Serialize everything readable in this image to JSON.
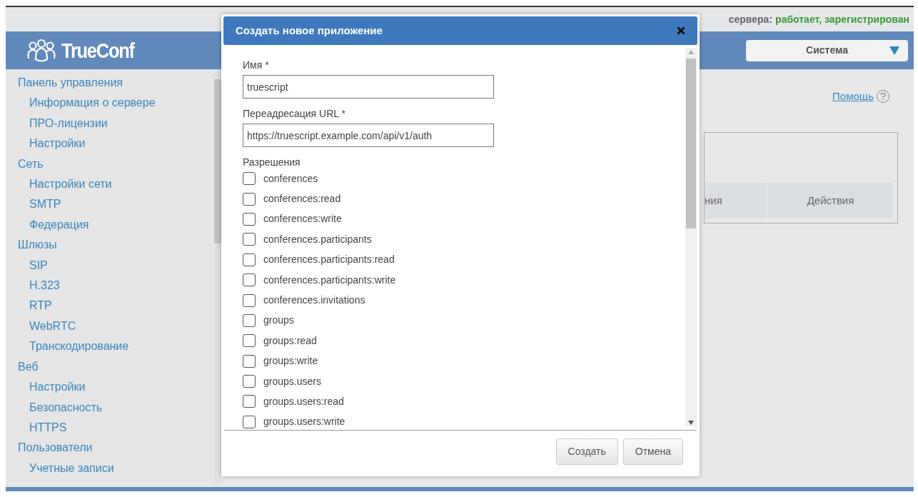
{
  "top_bar": {
    "status_label": "сервера:",
    "status_value": "работает, зарегистрирован"
  },
  "header": {
    "logo": "TrueConf",
    "menu": {
      "label": "Система",
      "expanded": false
    }
  },
  "sidebar": {
    "items": [
      {
        "label": "Панель управления",
        "children": [
          {
            "label": "Информация о сервере"
          },
          {
            "label": "ПРО-лицензии"
          },
          {
            "label": "Настройки"
          }
        ]
      },
      {
        "label": "Сеть",
        "children": [
          {
            "label": "Настройки сети"
          },
          {
            "label": "SMTP"
          },
          {
            "label": "Федерация"
          }
        ]
      },
      {
        "label": "Шлюзы",
        "children": [
          {
            "label": "SIP"
          },
          {
            "label": "H.323"
          },
          {
            "label": "RTP"
          },
          {
            "label": "WebRTC"
          },
          {
            "label": "Транскодирование"
          }
        ]
      },
      {
        "label": "Веб",
        "children": [
          {
            "label": "Настройки"
          },
          {
            "label": "Безопасность"
          },
          {
            "label": "HTTPS"
          }
        ]
      },
      {
        "label": "Пользователи",
        "children": [
          {
            "label": "Учетные записи"
          }
        ]
      }
    ]
  },
  "main": {
    "help_link": "Помощь",
    "table": {
      "columns": [
        "ния",
        "Действия"
      ]
    }
  },
  "dialog": {
    "title": "Создать новое приложение",
    "fields": [
      {
        "label": "Имя *",
        "value": "truescript"
      },
      {
        "label": "Переадресация URL *",
        "value": "https://truescript.example.com/api/v1/auth"
      }
    ],
    "permissions_label": "Разрешения",
    "permissions": [
      {
        "label": "conferences",
        "checked": false
      },
      {
        "label": "conferences:read",
        "checked": false
      },
      {
        "label": "conferences:write",
        "checked": false
      },
      {
        "label": "conferences.participants",
        "checked": false
      },
      {
        "label": "conferences.participants:read",
        "checked": false
      },
      {
        "label": "conferences.participants:write",
        "checked": false
      },
      {
        "label": "conferences.invitations",
        "checked": false
      },
      {
        "label": "groups",
        "checked": false
      },
      {
        "label": "groups:read",
        "checked": false
      },
      {
        "label": "groups:write",
        "checked": false
      },
      {
        "label": "groups.users",
        "checked": false
      },
      {
        "label": "groups.users:read",
        "checked": false
      },
      {
        "label": "groups.users:write",
        "checked": false
      }
    ],
    "buttons": [
      "Создать",
      "Отмена"
    ]
  }
}
